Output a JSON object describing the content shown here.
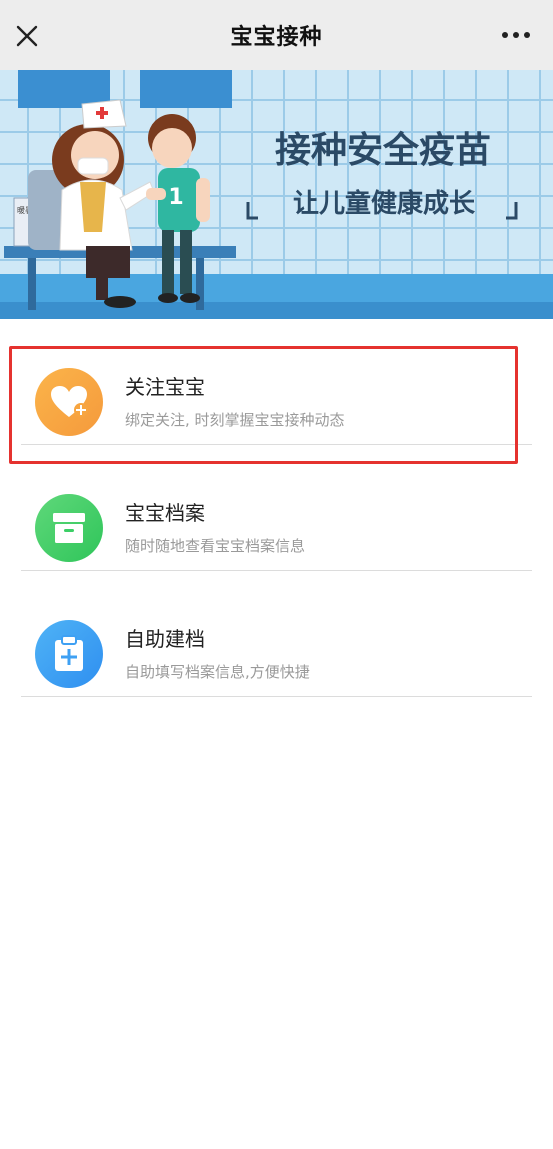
{
  "header": {
    "title": "宝宝接种",
    "close_icon": "close-icon",
    "more_icon": "more-icon"
  },
  "banner": {
    "headline": "接种安全疫苗",
    "subline": "让儿童健康成长",
    "sign_text": "暖暑接种"
  },
  "menu": {
    "items": [
      {
        "title": "关注宝宝",
        "subtitle": "绑定关注, 时刻掌握宝宝接种动态",
        "icon": "heart-icon",
        "color_start": "#fbb44a",
        "color_end": "#f59a3c",
        "highlighted": true
      },
      {
        "title": "宝宝档案",
        "subtitle": "随时随地查看宝宝档案信息",
        "icon": "archive-box-icon",
        "color_start": "#5fd87a",
        "color_end": "#2fc55a",
        "highlighted": false
      },
      {
        "title": "自助建档",
        "subtitle": "自助填写档案信息,方便快捷",
        "icon": "clipboard-plus-icon",
        "color_start": "#4fb3f6",
        "color_end": "#2f8ff0",
        "highlighted": false
      }
    ]
  },
  "colors": {
    "nav_bg": "#ededed",
    "highlight_border": "#e5322f"
  }
}
